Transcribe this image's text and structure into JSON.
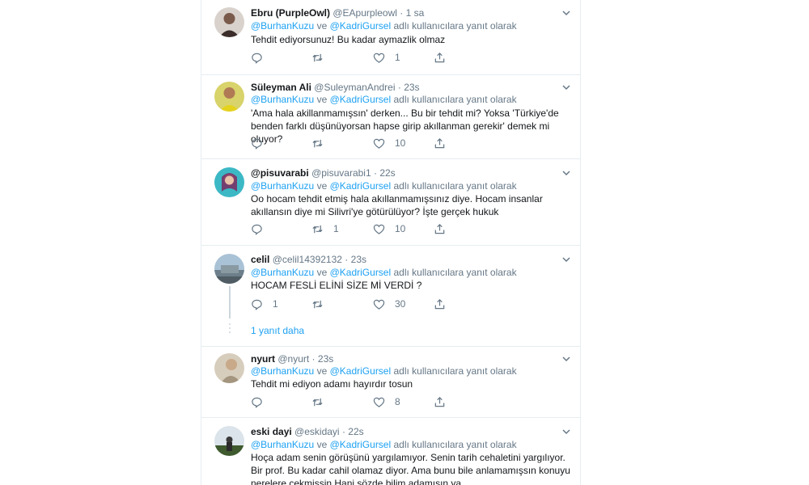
{
  "reply_prefix": "ve",
  "reply_suffix": "adlı kullanıcılara yanıt olarak",
  "mention_1": "@BurhanKuzu",
  "mention_2": "@KadriGursel",
  "tweets": [
    {
      "name": "Ebru (PurpleOwl)",
      "handle": "@EApurpleowl",
      "time": "1 sa",
      "text": "Tehdit ediyorsunuz! Bu kadar aymazlik olmaz",
      "replies": "",
      "retweets": "",
      "likes": "1"
    },
    {
      "name": "Süleyman Ali",
      "handle": "@SuleymanAndrei",
      "time": "23s",
      "text": "'Ama hala akillanmamışsın' derken... Bu bir tehdit mi? Yoksa 'Türkiye'de benden farklı düşünüyorsan hapse girip akıllanman gerekir' demek mi oluyor?",
      "replies": "",
      "retweets": "",
      "likes": "10"
    },
    {
      "name": "@pisuvarabi",
      "handle": "@pisuvarabi1",
      "time": "22s",
      "text": "Oo hocam tehdit etmiş hala akıllanmamışsınız diye. Hocam insanlar akıllansın diye mi Silivri'ye götürülüyor? İşte gerçek hukuk",
      "replies": "",
      "retweets": "1",
      "likes": "10"
    },
    {
      "name": "celil",
      "handle": "@celil14392132",
      "time": "23s",
      "text": "HOCAM FESLİ ELİNİ SİZE Mİ VERDİ ?",
      "replies": "1",
      "retweets": "",
      "likes": "30"
    },
    {
      "name": "nyurt",
      "handle": "@nyurt",
      "time": "23s",
      "text": "Tehdit mi ediyon adamı hayırdır tosun",
      "replies": "",
      "retweets": "",
      "likes": "8"
    },
    {
      "name": "eski dayi",
      "handle": "@eskidayi",
      "time": "22s",
      "text": "Hoça adam senin görüşünü yargılamıyor. Senin tarih cehaletini yargılıyor. Bir prof. Bu kadar cahil olamaz diyor. Ama bunu bile anlamamışsın konuyu nerelere cekmissin.Hani sözde bilim adamısın ya...",
      "replies": "",
      "retweets": "",
      "likes": ""
    }
  ],
  "show_more_replies": "1 yanıt daha",
  "colors": {
    "link": "#1da1f2",
    "muted": "#657786",
    "text": "#14171a",
    "divider": "#e6ecf0"
  },
  "icons": [
    "reply-icon",
    "retweet-icon",
    "like-icon",
    "share-icon",
    "chevron-down-icon"
  ]
}
